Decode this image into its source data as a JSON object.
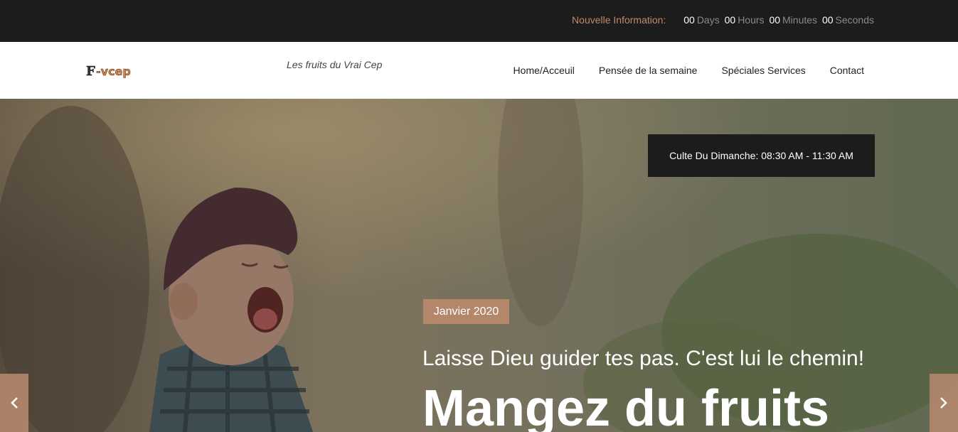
{
  "topbar": {
    "label": "Nouvelle Information:",
    "countdown": [
      {
        "num": "00",
        "unit": "Days"
      },
      {
        "num": "00",
        "unit": "Hours"
      },
      {
        "num": "00",
        "unit": "Minutes"
      },
      {
        "num": "00",
        "unit": "Seconds"
      }
    ]
  },
  "header": {
    "logo_text": "F-vcep",
    "tagline": "Les fruits du Vrai Cep",
    "nav": [
      "Home/Acceuil",
      "Pensée de la semaine",
      "Spéciales Services",
      "Contact"
    ]
  },
  "hero": {
    "service_info": "Culte Du Dimanche: 08:30 AM - 11:30 AM",
    "date_badge": "Janvier 2020",
    "subtitle": "Laisse Dieu guider tes pas. C'est lui le chemin!",
    "headline": "Mangez du fruits",
    "prev_icon": "chevron-left-icon",
    "next_icon": "chevron-right-icon"
  },
  "colors": {
    "accent": "#b4876b",
    "topbar_bg": "#1c1c1c",
    "label_color": "#c08a6a"
  }
}
